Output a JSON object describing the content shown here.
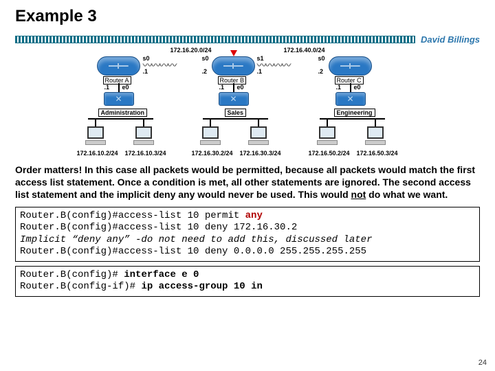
{
  "title": "Example 3",
  "author": "David Billings",
  "diagram": {
    "wan1_net": "172.16.20.0/24",
    "wan2_net": "172.16.40.0/24",
    "routerA": {
      "label": "Router A",
      "s0_if": "s0",
      "s0_addr": ".1",
      "e0_if": "e0",
      "e0_addr": ".1"
    },
    "routerB": {
      "label": "Router B",
      "s0_if": "s0",
      "s0_addr": ".2",
      "s1_if": "s1",
      "s1_addr": ".1",
      "e0_if": "e0",
      "e0_addr": ".1"
    },
    "routerC": {
      "label": "Router C",
      "s0_if": "s0",
      "s0_addr": ".2",
      "e0_if": "e0",
      "e0_addr": ".1"
    },
    "lan1": {
      "name": "Administration",
      "pc1_ip": "172.16.10.2/24",
      "pc2_ip": "172.16.10.3/24"
    },
    "lan2": {
      "name": "Sales",
      "pc1_ip": "172.16.30.2/24",
      "pc2_ip": "172.16.30.3/24"
    },
    "lan3": {
      "name": "Engineering",
      "pc1_ip": "172.16.50.2/24",
      "pc2_ip": "172.16.50.3/24"
    }
  },
  "para": {
    "p1a": "Order matters!  In this case all packets would be permitted, because all packets would match the first access list statement. Once a condition is met, all other statements are ignored.  The second access list statement and the implicit deny any would never be used.  This would ",
    "p1_not": "not",
    "p1b": " do what we want."
  },
  "code1": {
    "l1a": "Router.B(config)#access-list 10 permit ",
    "l1b": "any",
    "l2": "Router.B(config)#access-list 10 deny 172.16.30.2",
    "l3": "Implicit “deny any” -do not need to add this, discussed later",
    "l4": "Router.B(config)#access-list 10 deny 0.0.0.0 255.255.255.255"
  },
  "code2": {
    "l1a": "Router.B(config)# ",
    "l1b": "interface e 0",
    "l2a": "Router.B(config-if)# ",
    "l2b": "ip access-group 10 in"
  },
  "pagenum": "24"
}
